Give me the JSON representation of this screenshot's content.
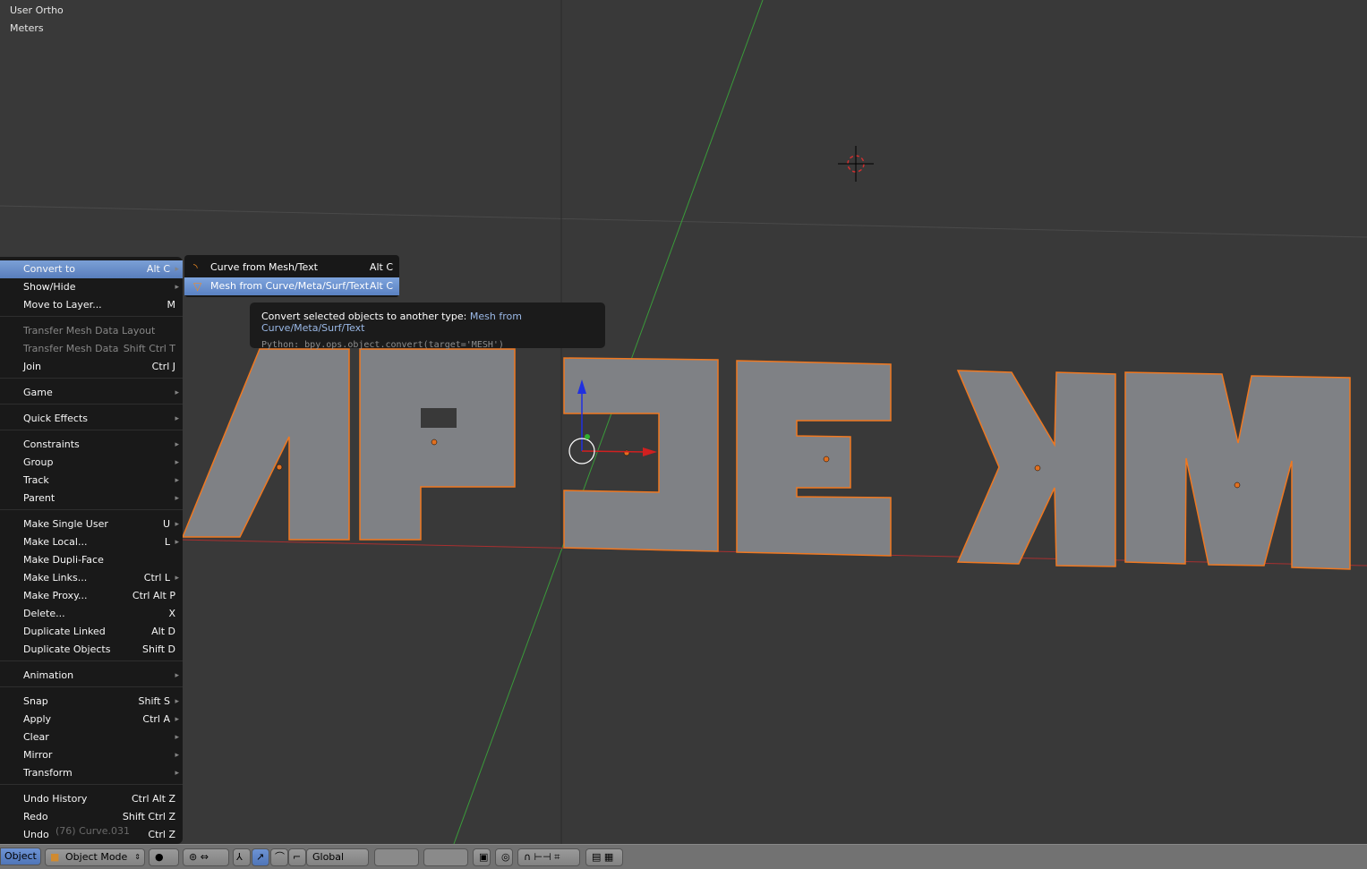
{
  "viewport": {
    "view_name": "User Ortho",
    "units": "Meters",
    "status_text": "(76) Curve.031"
  },
  "object_menu": {
    "items": [
      {
        "label": "Convert to",
        "shortcut": "Alt C",
        "submenu": true,
        "active": true
      },
      {
        "label": "Show/Hide",
        "shortcut": "",
        "submenu": true
      },
      {
        "label": "Move to Layer...",
        "shortcut": "M"
      },
      {
        "label": "Transfer Mesh Data Layout",
        "shortcut": "",
        "disabled": true
      },
      {
        "label": "Transfer Mesh Data",
        "shortcut": "Shift Ctrl T",
        "disabled": true
      },
      {
        "label": "Join",
        "shortcut": "Ctrl J"
      },
      {
        "label": "Game",
        "shortcut": "",
        "submenu": true
      },
      {
        "label": "Quick Effects",
        "shortcut": "",
        "submenu": true
      },
      {
        "label": "Constraints",
        "shortcut": "",
        "submenu": true
      },
      {
        "label": "Group",
        "shortcut": "",
        "submenu": true
      },
      {
        "label": "Track",
        "shortcut": "",
        "submenu": true
      },
      {
        "label": "Parent",
        "shortcut": "",
        "submenu": true
      },
      {
        "label": "Make Single User",
        "shortcut": "U",
        "submenu": true
      },
      {
        "label": "Make Local...",
        "shortcut": "L",
        "submenu": true
      },
      {
        "label": "Make Dupli-Face",
        "shortcut": ""
      },
      {
        "label": "Make Links...",
        "shortcut": "Ctrl L",
        "submenu": true
      },
      {
        "label": "Make Proxy...",
        "shortcut": "Ctrl Alt P"
      },
      {
        "label": "Delete...",
        "shortcut": "X"
      },
      {
        "label": "Duplicate Linked",
        "shortcut": "Alt D"
      },
      {
        "label": "Duplicate Objects",
        "shortcut": "Shift D"
      },
      {
        "label": "Animation",
        "shortcut": "",
        "submenu": true
      },
      {
        "label": "Snap",
        "shortcut": "Shift S",
        "submenu": true
      },
      {
        "label": "Apply",
        "shortcut": "Ctrl A",
        "submenu": true
      },
      {
        "label": "Clear",
        "shortcut": "",
        "submenu": true
      },
      {
        "label": "Mirror",
        "shortcut": "",
        "submenu": true
      },
      {
        "label": "Transform",
        "shortcut": "",
        "submenu": true
      },
      {
        "label": "Undo History",
        "shortcut": "Ctrl Alt Z"
      },
      {
        "label": "Redo",
        "shortcut": "Shift Ctrl Z"
      },
      {
        "label": "Undo",
        "shortcut": "Ctrl Z"
      }
    ]
  },
  "convert_submenu": {
    "items": [
      {
        "label": "Curve from Mesh/Text",
        "shortcut": "Alt C",
        "icon": "curve-icon"
      },
      {
        "label": "Mesh from Curve/Meta/Surf/Text",
        "shortcut": "Alt C",
        "icon": "mesh-icon",
        "active": true
      }
    ]
  },
  "tooltip": {
    "description": "Convert selected objects to another type:",
    "highlight": "Mesh from Curve/Meta/Surf/Text",
    "python": "Python: bpy.ops.object.convert(target='MESH')"
  },
  "header": {
    "menu_label": "Object",
    "mode": "Object Mode",
    "orientation": "Global"
  },
  "colors": {
    "selection_outline": "#f07820",
    "object_fill": "#7f8185",
    "menu_highlight": "#6a90d0",
    "x_axis": "#c83c3c",
    "y_axis": "#3cb43c"
  }
}
